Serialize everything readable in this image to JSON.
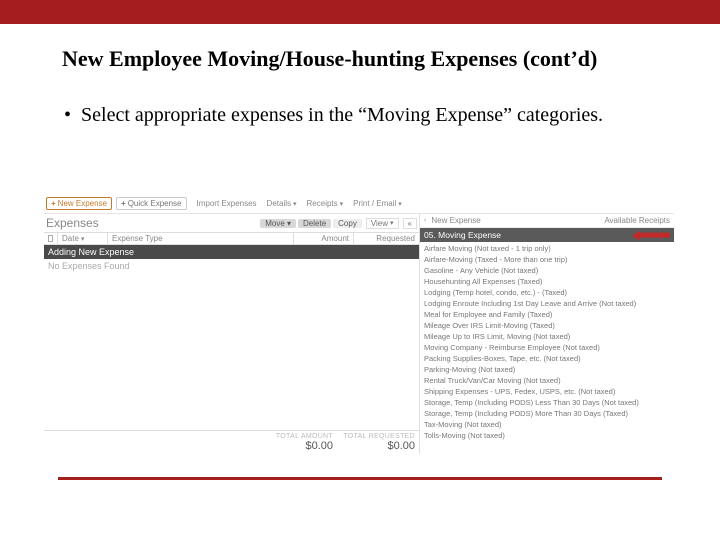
{
  "title": "New Employee Moving/House-hunting Expenses (cont’d)",
  "bullet": "Select appropriate expenses in the “Moving Expense” categories.",
  "toolbar": {
    "new_expense": "New Expense",
    "quick_expense": "Quick Expense",
    "import_expenses": "Import Expenses",
    "details": "Details",
    "receipts": "Receipts",
    "print_email": "Print / Email"
  },
  "expenses": {
    "title": "Expenses",
    "move_btn": "Move",
    "delete_btn": "Delete",
    "copy_btn": "Copy",
    "view_label": "View",
    "cols": {
      "date": "Date",
      "type": "Expense Type",
      "amount": "Amount",
      "requested": "Requested"
    },
    "adding": "Adding New Expense",
    "none": "No Expenses Found",
    "total_amount_label": "TOTAL AMOUNT",
    "total_requested_label": "TOTAL REQUESTED",
    "total_amount": "$0.00",
    "total_requested": "$0.00"
  },
  "side": {
    "breadcrumb": "New Expense",
    "available": "Available Receipts",
    "category": "05. Moving Expense",
    "items": [
      "Airfare Moving (Not taxed - 1 trip only)",
      "Airfare-Moving (Taxed - More than one trip)",
      "Gasoline - Any Vehicle (Not taxed)",
      "Househunting All Expenses (Taxed)",
      "Lodging (Temp hotel, condo, etc.) - (Taxed)",
      "Lodging Enroute Including 1st Day Leave and Arrive (Not taxed)",
      "Meal for Employee and Family (Taxed)",
      "Mileage Over IRS Limit-Moving (Taxed)",
      "Mileage Up to IRS Limit, Moving (Not taxed)",
      "Moving Company - Reimburse Employee (Not taxed)",
      "Packing Supplies-Boxes, Tape, etc. (Not taxed)",
      "Parking-Moving (Not taxed)",
      "Rental Truck/Van/Car Moving (Not taxed)",
      "Shipping Expenses - UPS, Fedex, USPS, etc. (Not taxed)",
      "Storage, Temp (Including PODS) Less Than 30 Days (Not taxed)",
      "Storage, Temp (Including PODS) More Than 30 Days (Taxed)",
      "Tax-Moving (Not taxed)",
      "Tolls-Moving (Not taxed)"
    ]
  }
}
